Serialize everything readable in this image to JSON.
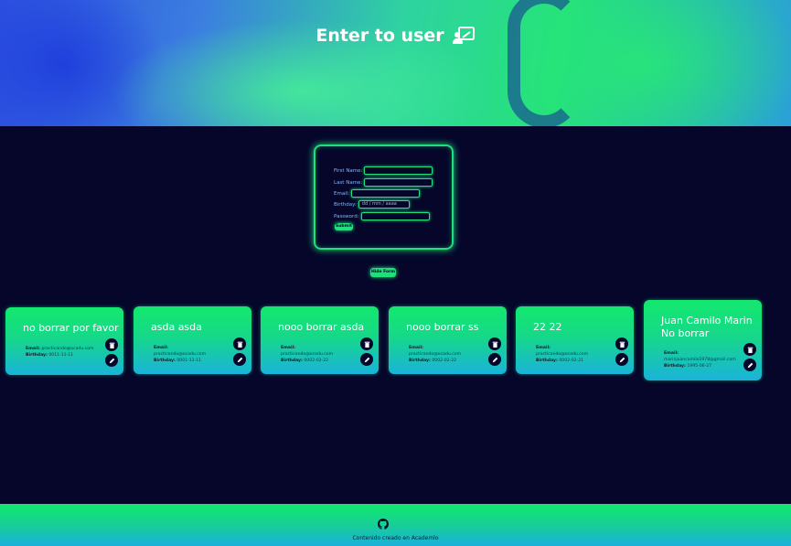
{
  "header": {
    "title": "Enter to user",
    "icon": "user-presentation-icon"
  },
  "form": {
    "fields": [
      {
        "label": "First Name:",
        "value": ""
      },
      {
        "label": "Last Name:",
        "value": ""
      },
      {
        "label": "Email:",
        "value": ""
      },
      {
        "label": "Birthday:",
        "placeholder": "dd / mm / aaaa"
      },
      {
        "label": "Password:",
        "value": ""
      }
    ],
    "submit_label": "Submit",
    "hide_label": "Hide Form"
  },
  "users": [
    {
      "name": "no borrar por favor",
      "email_label": "Email:",
      "email": "practicando@ocadu.com",
      "birthday_label": "Birthday:",
      "birthday": "0011-11-11"
    },
    {
      "name": "asda asda",
      "email_label": "Email:",
      "email": "practicando@ocadu.com",
      "birthday_label": "Birthday:",
      "birthday": "0001-11-11"
    },
    {
      "name": "nooo borrar asda",
      "email_label": "Email:",
      "email": "practicando@ocadu.com",
      "birthday_label": "Birthday:",
      "birthday": "0002-02-22"
    },
    {
      "name": "nooo borrar ss",
      "email_label": "Email:",
      "email": "practicando@ocadu.com",
      "birthday_label": "Birthday:",
      "birthday": "0002-02-22"
    },
    {
      "name": "22 22",
      "email_label": "Email:",
      "email": "practicando@ocadu.com",
      "birthday_label": "Birthday:",
      "birthday": "0002-02-21"
    },
    {
      "name": "Juan Camilo Marin No borrar",
      "email_label": "Email:",
      "email": "marinjuancamilo1978@gmail.com",
      "birthday_label": "Birthday:",
      "birthday": "1995-06-27"
    }
  ],
  "footer": {
    "icon": "github-icon",
    "text": "Contenido creado en Academlo"
  },
  "colors": {
    "background": "#05062a",
    "accent": "#1fe07a",
    "card_top": "#13e86d",
    "card_bottom": "#1ab3d9"
  }
}
